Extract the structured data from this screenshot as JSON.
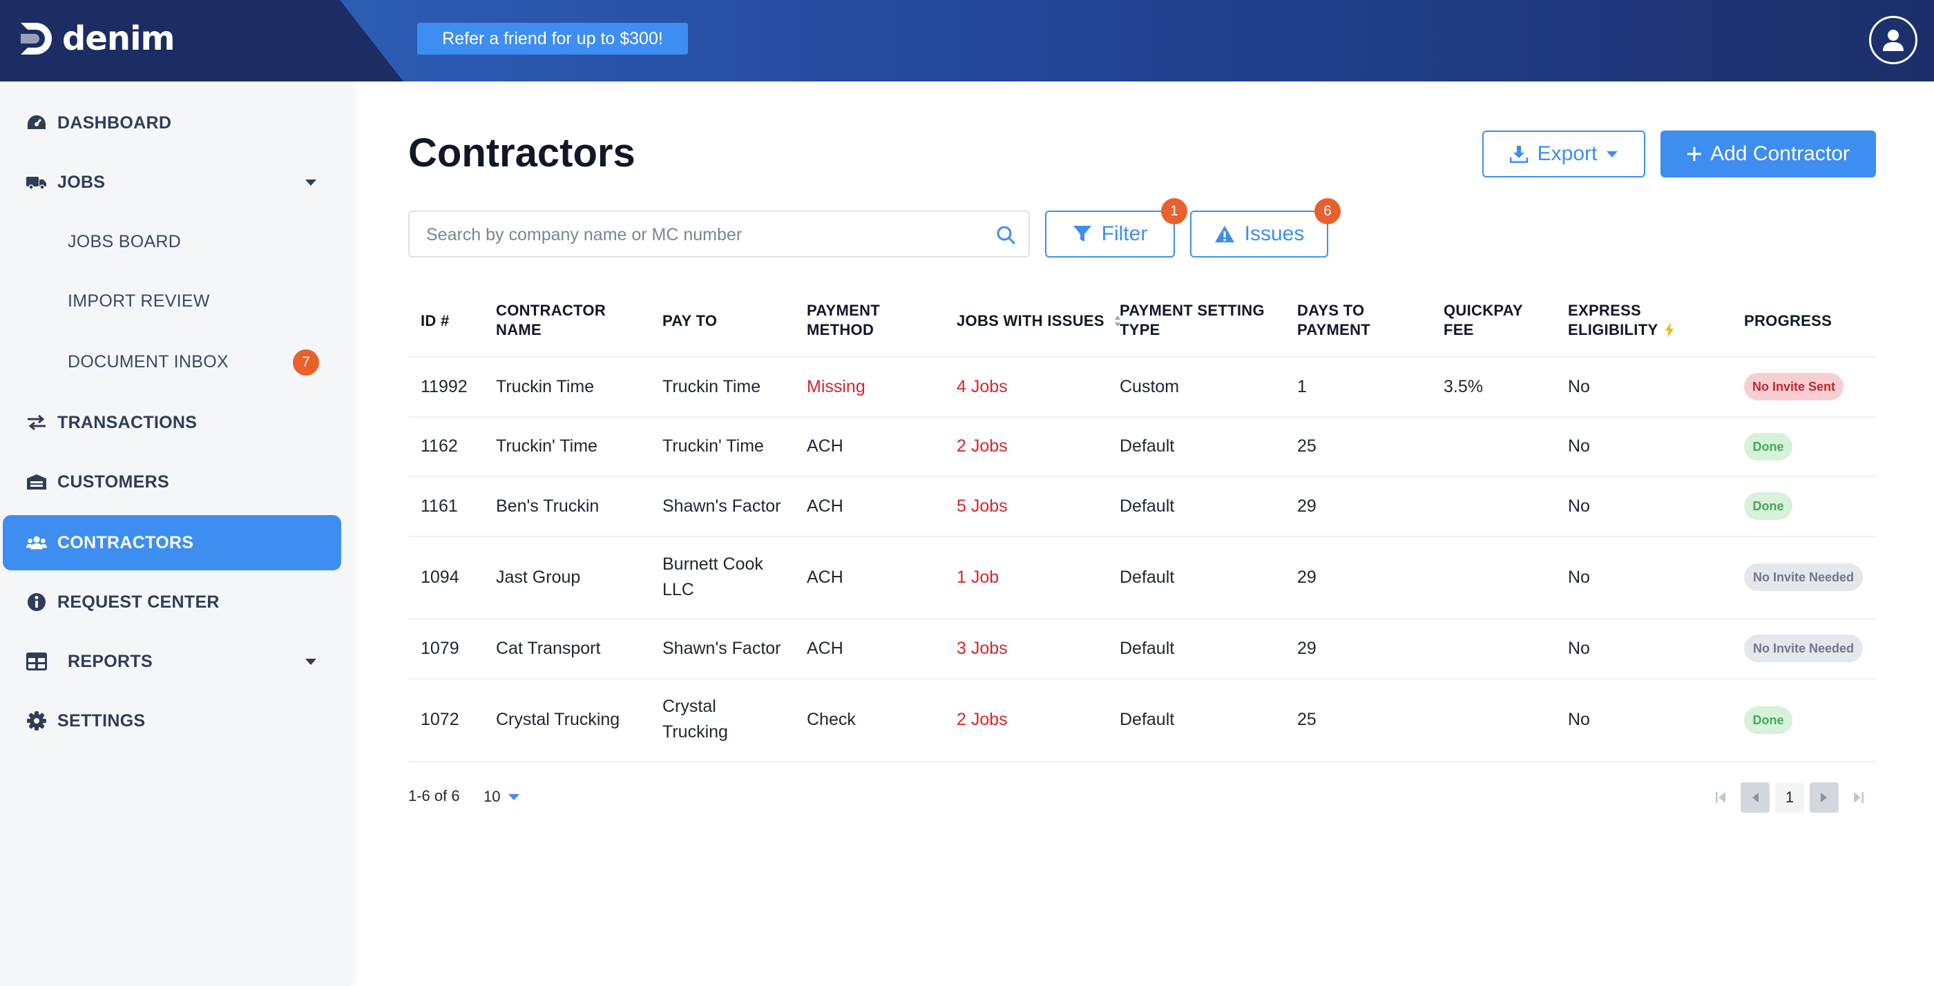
{
  "brand": {
    "name": "denim"
  },
  "header": {
    "referral_label": "Refer a friend for up to $300!"
  },
  "sidebar": {
    "items": [
      {
        "label": "DASHBOARD",
        "icon": "dashboard-icon"
      },
      {
        "label": "JOBS",
        "icon": "truck-icon"
      },
      {
        "label": "JOBS BOARD"
      },
      {
        "label": "IMPORT REVIEW"
      },
      {
        "label": "DOCUMENT INBOX",
        "badge": "7"
      },
      {
        "label": "TRANSACTIONS",
        "icon": "transfer-icon"
      },
      {
        "label": "CUSTOMERS",
        "icon": "warehouse-icon"
      },
      {
        "label": "CONTRACTORS",
        "icon": "users-icon",
        "active": true
      },
      {
        "label": "REQUEST CENTER",
        "icon": "info-icon"
      },
      {
        "label": "REPORTS",
        "icon": "table-icon"
      },
      {
        "label": "SETTINGS",
        "icon": "gear-icon"
      }
    ]
  },
  "page": {
    "title": "Contractors",
    "export_label": "Export",
    "add_label": "Add Contractor",
    "search_placeholder": "Search by company name or MC number",
    "filter_label": "Filter",
    "filter_count": "1",
    "issues_label": "Issues",
    "issues_count": "6"
  },
  "table": {
    "headers": {
      "id": "ID #",
      "name_1": "CONTRACTOR",
      "name_2": "NAME",
      "pay_to": "PAY TO",
      "method_1": "PAYMENT",
      "method_2": "METHOD",
      "jobs_issues": "JOBS WITH ISSUES",
      "setting_1": "PAYMENT SETTING",
      "setting_2": "TYPE",
      "days_1": "DAYS TO",
      "days_2": "PAYMENT",
      "fee_1": "QUICKPAY",
      "fee_2": "FEE",
      "express_1": "EXPRESS",
      "express_2": "ELIGIBILITY",
      "progress": "PROGRESS"
    },
    "rows": [
      {
        "id": "11992",
        "name": "Truckin Time",
        "pay_to_1": "Truckin Time",
        "pay_to_2": "",
        "method": "Missing",
        "jobs": "4 Jobs",
        "setting": "Custom",
        "days": "1",
        "fee": "3.5%",
        "express": "No",
        "progress": "No Invite Sent"
      },
      {
        "id": "1162",
        "name": "Truckin' Time",
        "pay_to_1": "Truckin' Time",
        "pay_to_2": "",
        "method": "ACH",
        "jobs": "2 Jobs",
        "setting": "Default",
        "days": "25",
        "fee": "",
        "express": "No",
        "progress": "Done"
      },
      {
        "id": "1161",
        "name": "Ben's Truckin",
        "pay_to_1": "Shawn's Factor",
        "pay_to_2": "",
        "method": "ACH",
        "jobs": "5 Jobs",
        "setting": "Default",
        "days": "29",
        "fee": "",
        "express": "No",
        "progress": "Done"
      },
      {
        "id": "1094",
        "name": "Jast Group",
        "pay_to_1": "Burnett Cook",
        "pay_to_2": "LLC",
        "method": "ACH",
        "jobs": "1 Job",
        "setting": "Default",
        "days": "29",
        "fee": "",
        "express": "No",
        "progress": "No Invite Needed"
      },
      {
        "id": "1079",
        "name": "Cat Transport",
        "pay_to_1": "Shawn's Factor",
        "pay_to_2": "",
        "method": "ACH",
        "jobs": "3 Jobs",
        "setting": "Default",
        "days": "29",
        "fee": "",
        "express": "No",
        "progress": "No Invite Needed"
      },
      {
        "id": "1072",
        "name": "Crystal Trucking",
        "pay_to_1": "Crystal",
        "pay_to_2": "Trucking",
        "method": "Check",
        "jobs": "2 Jobs",
        "setting": "Default",
        "days": "25",
        "fee": "",
        "express": "No",
        "progress": "Done"
      }
    ]
  },
  "pagination": {
    "range": "1-6 of 6",
    "per_page": "10",
    "current_page": "1"
  },
  "colors": {
    "accent": "#3d8ef0",
    "navy": "#1b2d63",
    "danger": "#d6262c",
    "badge": "#e8602c"
  }
}
